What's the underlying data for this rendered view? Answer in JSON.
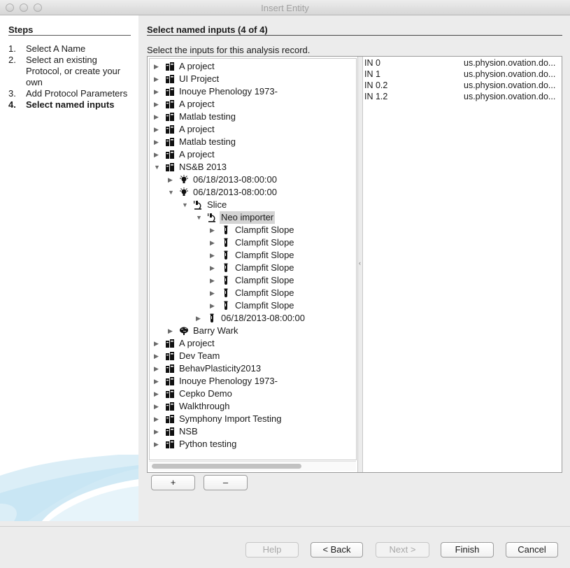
{
  "window": {
    "title": "Insert Entity"
  },
  "steps": {
    "heading": "Steps",
    "items": [
      {
        "num": "1.",
        "label": "Select A Name"
      },
      {
        "num": "2.",
        "label": "Select an existing Protocol, or create your own"
      },
      {
        "num": "3.",
        "label": "Add Protocol Parameters"
      },
      {
        "num": "4.",
        "label": "Select named inputs"
      }
    ]
  },
  "content": {
    "title": "Select named inputs (4 of 4)",
    "instruction": "Select the inputs for this analysis record."
  },
  "tree": [
    {
      "label": "A project",
      "icon": "project-icon",
      "expanded": false,
      "depth": 0
    },
    {
      "label": "UI Project",
      "icon": "project-icon",
      "expanded": false,
      "depth": 0
    },
    {
      "label": "Inouye Phenology 1973-",
      "icon": "project-icon",
      "expanded": false,
      "depth": 0
    },
    {
      "label": "A project",
      "icon": "project-icon",
      "expanded": false,
      "depth": 0
    },
    {
      "label": "Matlab testing",
      "icon": "project-icon",
      "expanded": false,
      "depth": 0
    },
    {
      "label": "A project",
      "icon": "project-icon",
      "expanded": false,
      "depth": 0
    },
    {
      "label": "Matlab testing",
      "icon": "project-icon",
      "expanded": false,
      "depth": 0
    },
    {
      "label": "A project",
      "icon": "project-icon",
      "expanded": false,
      "depth": 0
    },
    {
      "label": "NS&B 2013",
      "icon": "project-icon",
      "expanded": true,
      "depth": 0
    },
    {
      "label": "06/18/2013-08:00:00",
      "icon": "experiment-bulb-icon",
      "expanded": false,
      "depth": 1
    },
    {
      "label": "06/18/2013-08:00:00",
      "icon": "experiment-bulb-icon",
      "expanded": true,
      "depth": 1
    },
    {
      "label": "Slice",
      "icon": "microscope-icon",
      "expanded": true,
      "depth": 2
    },
    {
      "label": "Neo importer",
      "icon": "microscope-icon",
      "expanded": true,
      "depth": 3,
      "selected": true
    },
    {
      "label": "Clampfit Slope",
      "icon": "test-tube-icon",
      "expanded": false,
      "depth": 4
    },
    {
      "label": "Clampfit Slope",
      "icon": "test-tube-icon",
      "expanded": false,
      "depth": 4
    },
    {
      "label": "Clampfit Slope",
      "icon": "test-tube-icon",
      "expanded": false,
      "depth": 4
    },
    {
      "label": "Clampfit Slope",
      "icon": "test-tube-icon",
      "expanded": false,
      "depth": 4
    },
    {
      "label": "Clampfit Slope",
      "icon": "test-tube-icon",
      "expanded": false,
      "depth": 4
    },
    {
      "label": "Clampfit Slope",
      "icon": "test-tube-icon",
      "expanded": false,
      "depth": 4
    },
    {
      "label": "Clampfit Slope",
      "icon": "test-tube-icon",
      "expanded": false,
      "depth": 4
    },
    {
      "label": "06/18/2013-08:00:00",
      "icon": "test-tube-icon",
      "expanded": false,
      "depth": 3
    },
    {
      "label": "Barry Wark",
      "icon": "brain-icon",
      "expanded": false,
      "depth": 1
    },
    {
      "label": "A project",
      "icon": "project-icon",
      "expanded": false,
      "depth": 0
    },
    {
      "label": "Dev Team",
      "icon": "project-icon",
      "expanded": false,
      "depth": 0
    },
    {
      "label": "BehavPlasticity2013",
      "icon": "project-icon",
      "expanded": false,
      "depth": 0
    },
    {
      "label": "Inouye Phenology 1973-",
      "icon": "project-icon",
      "expanded": false,
      "depth": 0
    },
    {
      "label": "Cepko Demo",
      "icon": "project-icon",
      "expanded": false,
      "depth": 0
    },
    {
      "label": "Walkthrough",
      "icon": "project-icon",
      "expanded": false,
      "depth": 0
    },
    {
      "label": "Symphony Import Testing",
      "icon": "project-icon",
      "expanded": false,
      "depth": 0
    },
    {
      "label": "NSB",
      "icon": "project-icon",
      "expanded": false,
      "depth": 0
    },
    {
      "label": "Python testing",
      "icon": "project-icon",
      "expanded": false,
      "depth": 0
    }
  ],
  "inputs": [
    {
      "name": "IN 0",
      "uri": "us.physion.ovation.do..."
    },
    {
      "name": "IN 1",
      "uri": "us.physion.ovation.do..."
    },
    {
      "name": "IN 0.2",
      "uri": "us.physion.ovation.do..."
    },
    {
      "name": "IN 1.2",
      "uri": "us.physion.ovation.do..."
    }
  ],
  "buttons": {
    "add": "+",
    "remove": "–",
    "help": "Help",
    "back": "< Back",
    "next": "Next >",
    "finish": "Finish",
    "cancel": "Cancel"
  }
}
